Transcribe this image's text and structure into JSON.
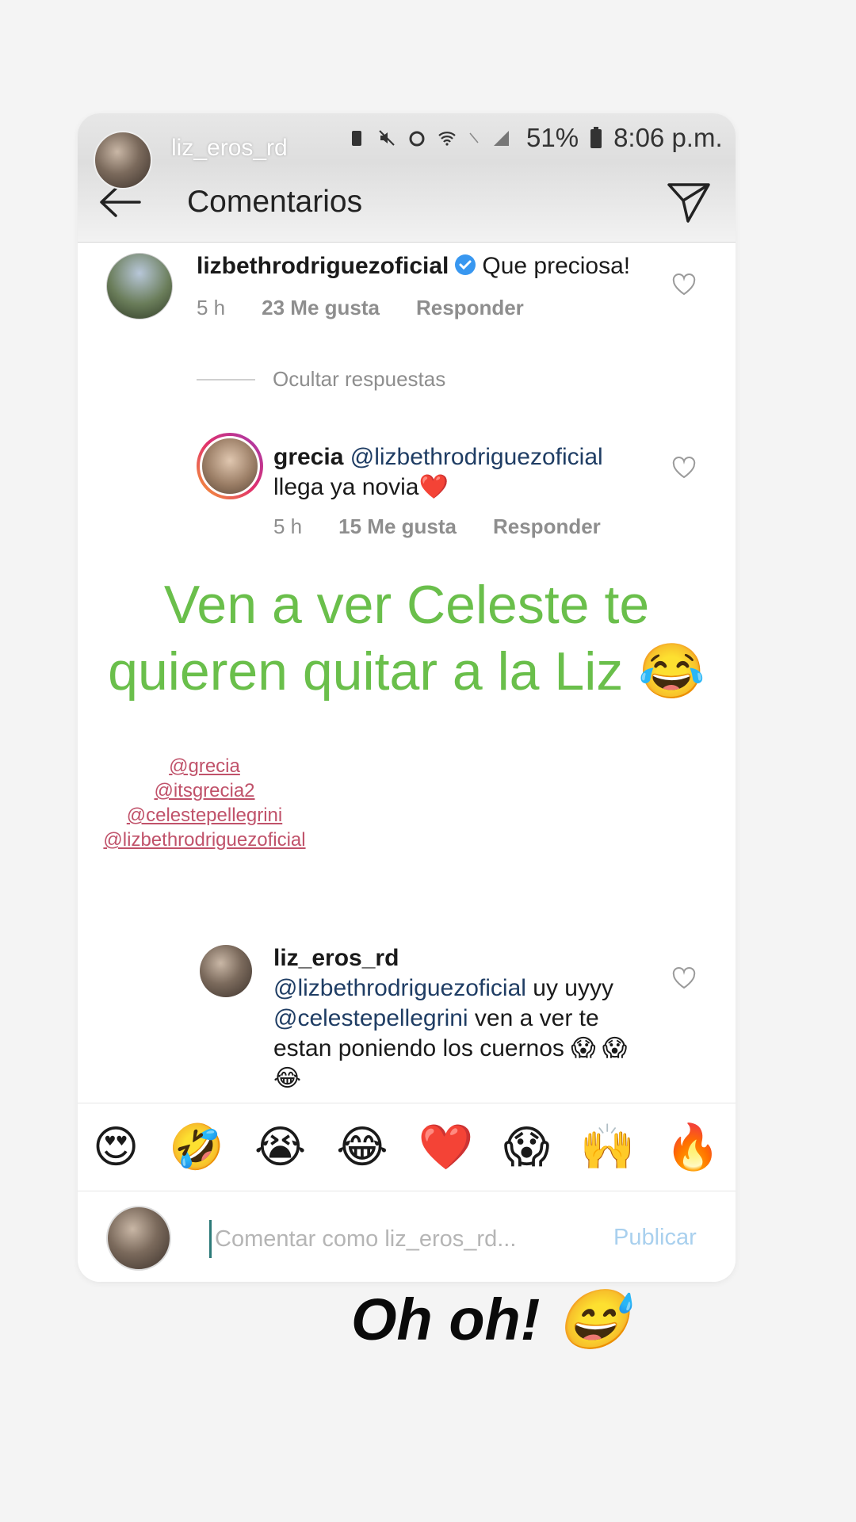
{
  "story": {
    "username": "liz_eros_rd"
  },
  "statusbar": {
    "battery": "51%",
    "time": "8:06 p.m."
  },
  "appbar": {
    "title": "Comentarios"
  },
  "comments": [
    {
      "user": "lizbethrodriguezoficial",
      "text": "Que preciosa!",
      "time": "5 h",
      "likes": "23 Me gusta",
      "reply": "Responder"
    },
    {
      "user": "grecia",
      "mention": "@lizbethrodriguezoficial",
      "text": "llega ya novia❤️",
      "time": "5 h",
      "likes": "15 Me gusta",
      "reply": "Responder"
    },
    {
      "user": "liz_eros_rd",
      "mention1": "@lizbethrodriguezoficial",
      "text1": " uy uyyy",
      "mention2": "@celestepellegrini",
      "text2": " ven a ver te estan poniendo los cuernos 😱 😱😂"
    }
  ],
  "hide_replies": "Ocultar respuestas",
  "overlay": {
    "line1": "Ven a ver Celeste te",
    "line2": "quieren quitar a la Liz 😂"
  },
  "tags": [
    "@grecia",
    "@itsgrecia2",
    "@celestepellegrini",
    "@lizbethrodriguezoficial"
  ],
  "emoji_bar": [
    "😍",
    "🤣",
    "😭",
    "😂",
    "❤️",
    "😱",
    "🙌",
    "🔥"
  ],
  "input": {
    "placeholder": "Comentar como liz_eros_rd...",
    "publish": "Publicar"
  },
  "caption": "Oh oh! 😅"
}
